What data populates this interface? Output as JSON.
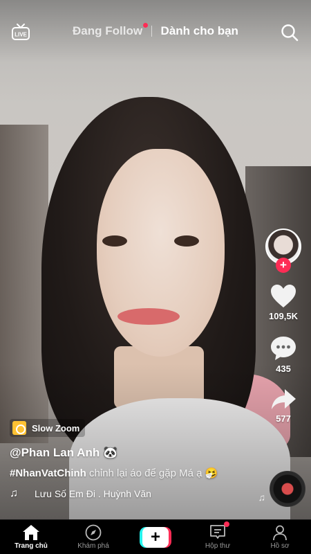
{
  "topbar": {
    "live_icon": "live-tv-icon",
    "tabs": [
      {
        "label": "Đang Follow",
        "has_dot": true
      },
      {
        "label": "Dành cho bạn",
        "active": true
      }
    ],
    "search_icon": "search-icon"
  },
  "rail": {
    "avatar_icon": "creator-avatar",
    "follow_icon": "plus-icon",
    "likes": "109,5K",
    "comments": "435",
    "shares": "577"
  },
  "video_info": {
    "effect_label": "Slow Zoom",
    "username": "@Phan Lan Anh 🐼",
    "hashtag": "#NhanVatChinh",
    "caption": " chỉnh lại áo để gặp Má ạ 🤧",
    "music_note": "♫",
    "music_text": "Lưu Số Em Đi . Huỳnh Văn",
    "floating_note": "♫"
  },
  "bottom_nav": {
    "home": "Trang chủ",
    "discover": "Khám phá",
    "create": "+",
    "inbox": "Hộp thư",
    "profile": "Hồ sơ"
  },
  "colors": {
    "accent_red": "#fe2c55",
    "accent_cyan": "#25f4ee",
    "effect_yellow": "#ffc233"
  }
}
